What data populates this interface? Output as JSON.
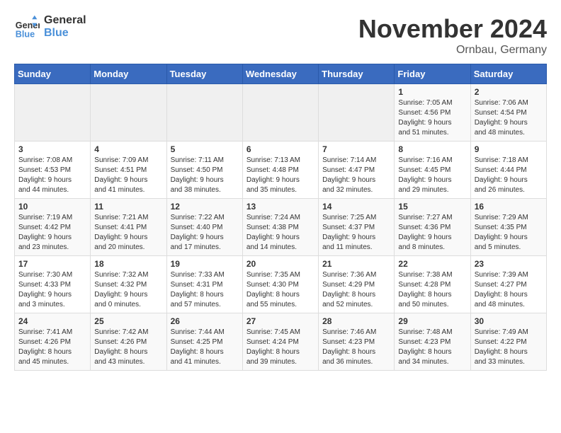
{
  "logo": {
    "line1": "General",
    "line2": "Blue"
  },
  "title": "November 2024",
  "location": "Ornbau, Germany",
  "weekdays": [
    "Sunday",
    "Monday",
    "Tuesday",
    "Wednesday",
    "Thursday",
    "Friday",
    "Saturday"
  ],
  "weeks": [
    [
      {
        "day": "",
        "info": ""
      },
      {
        "day": "",
        "info": ""
      },
      {
        "day": "",
        "info": ""
      },
      {
        "day": "",
        "info": ""
      },
      {
        "day": "",
        "info": ""
      },
      {
        "day": "1",
        "info": "Sunrise: 7:05 AM\nSunset: 4:56 PM\nDaylight: 9 hours\nand 51 minutes."
      },
      {
        "day": "2",
        "info": "Sunrise: 7:06 AM\nSunset: 4:54 PM\nDaylight: 9 hours\nand 48 minutes."
      }
    ],
    [
      {
        "day": "3",
        "info": "Sunrise: 7:08 AM\nSunset: 4:53 PM\nDaylight: 9 hours\nand 44 minutes."
      },
      {
        "day": "4",
        "info": "Sunrise: 7:09 AM\nSunset: 4:51 PM\nDaylight: 9 hours\nand 41 minutes."
      },
      {
        "day": "5",
        "info": "Sunrise: 7:11 AM\nSunset: 4:50 PM\nDaylight: 9 hours\nand 38 minutes."
      },
      {
        "day": "6",
        "info": "Sunrise: 7:13 AM\nSunset: 4:48 PM\nDaylight: 9 hours\nand 35 minutes."
      },
      {
        "day": "7",
        "info": "Sunrise: 7:14 AM\nSunset: 4:47 PM\nDaylight: 9 hours\nand 32 minutes."
      },
      {
        "day": "8",
        "info": "Sunrise: 7:16 AM\nSunset: 4:45 PM\nDaylight: 9 hours\nand 29 minutes."
      },
      {
        "day": "9",
        "info": "Sunrise: 7:18 AM\nSunset: 4:44 PM\nDaylight: 9 hours\nand 26 minutes."
      }
    ],
    [
      {
        "day": "10",
        "info": "Sunrise: 7:19 AM\nSunset: 4:42 PM\nDaylight: 9 hours\nand 23 minutes."
      },
      {
        "day": "11",
        "info": "Sunrise: 7:21 AM\nSunset: 4:41 PM\nDaylight: 9 hours\nand 20 minutes."
      },
      {
        "day": "12",
        "info": "Sunrise: 7:22 AM\nSunset: 4:40 PM\nDaylight: 9 hours\nand 17 minutes."
      },
      {
        "day": "13",
        "info": "Sunrise: 7:24 AM\nSunset: 4:38 PM\nDaylight: 9 hours\nand 14 minutes."
      },
      {
        "day": "14",
        "info": "Sunrise: 7:25 AM\nSunset: 4:37 PM\nDaylight: 9 hours\nand 11 minutes."
      },
      {
        "day": "15",
        "info": "Sunrise: 7:27 AM\nSunset: 4:36 PM\nDaylight: 9 hours\nand 8 minutes."
      },
      {
        "day": "16",
        "info": "Sunrise: 7:29 AM\nSunset: 4:35 PM\nDaylight: 9 hours\nand 5 minutes."
      }
    ],
    [
      {
        "day": "17",
        "info": "Sunrise: 7:30 AM\nSunset: 4:33 PM\nDaylight: 9 hours\nand 3 minutes."
      },
      {
        "day": "18",
        "info": "Sunrise: 7:32 AM\nSunset: 4:32 PM\nDaylight: 9 hours\nand 0 minutes."
      },
      {
        "day": "19",
        "info": "Sunrise: 7:33 AM\nSunset: 4:31 PM\nDaylight: 8 hours\nand 57 minutes."
      },
      {
        "day": "20",
        "info": "Sunrise: 7:35 AM\nSunset: 4:30 PM\nDaylight: 8 hours\nand 55 minutes."
      },
      {
        "day": "21",
        "info": "Sunrise: 7:36 AM\nSunset: 4:29 PM\nDaylight: 8 hours\nand 52 minutes."
      },
      {
        "day": "22",
        "info": "Sunrise: 7:38 AM\nSunset: 4:28 PM\nDaylight: 8 hours\nand 50 minutes."
      },
      {
        "day": "23",
        "info": "Sunrise: 7:39 AM\nSunset: 4:27 PM\nDaylight: 8 hours\nand 48 minutes."
      }
    ],
    [
      {
        "day": "24",
        "info": "Sunrise: 7:41 AM\nSunset: 4:26 PM\nDaylight: 8 hours\nand 45 minutes."
      },
      {
        "day": "25",
        "info": "Sunrise: 7:42 AM\nSunset: 4:26 PM\nDaylight: 8 hours\nand 43 minutes."
      },
      {
        "day": "26",
        "info": "Sunrise: 7:44 AM\nSunset: 4:25 PM\nDaylight: 8 hours\nand 41 minutes."
      },
      {
        "day": "27",
        "info": "Sunrise: 7:45 AM\nSunset: 4:24 PM\nDaylight: 8 hours\nand 39 minutes."
      },
      {
        "day": "28",
        "info": "Sunrise: 7:46 AM\nSunset: 4:23 PM\nDaylight: 8 hours\nand 36 minutes."
      },
      {
        "day": "29",
        "info": "Sunrise: 7:48 AM\nSunset: 4:23 PM\nDaylight: 8 hours\nand 34 minutes."
      },
      {
        "day": "30",
        "info": "Sunrise: 7:49 AM\nSunset: 4:22 PM\nDaylight: 8 hours\nand 33 minutes."
      }
    ]
  ]
}
